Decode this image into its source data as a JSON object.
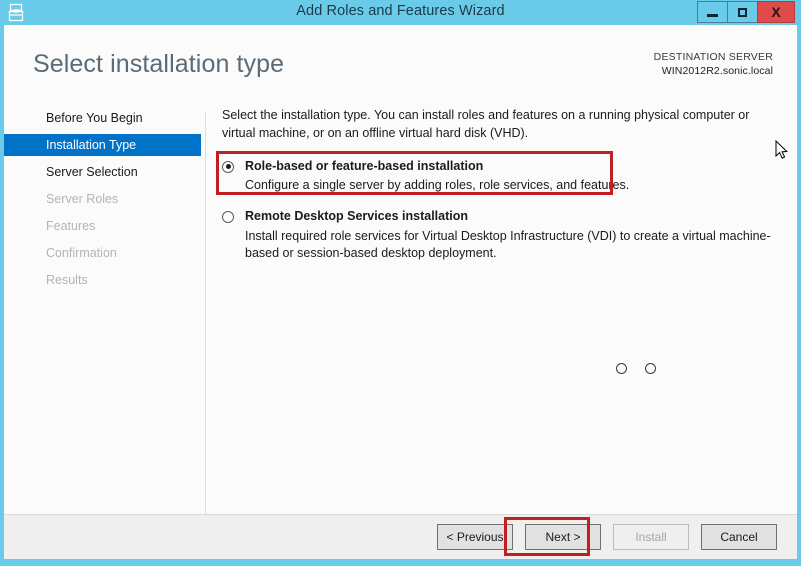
{
  "window": {
    "title": "Add Roles and Features Wizard",
    "icon": "server-wizard-icon",
    "titlebar_color": "#6ACBE8",
    "controls": {
      "minimize": "minimize-icon",
      "maximize": "maximize-icon",
      "close_label": "X"
    }
  },
  "header": {
    "page_title": "Select installation type",
    "destination_label": "DESTINATION SERVER",
    "destination_server": "WIN2012R2.sonic.local"
  },
  "sidebar": {
    "items": [
      {
        "label": "Before You Begin",
        "state": "enabled"
      },
      {
        "label": "Installation Type",
        "state": "selected"
      },
      {
        "label": "Server Selection",
        "state": "enabled"
      },
      {
        "label": "Server Roles",
        "state": "disabled"
      },
      {
        "label": "Features",
        "state": "disabled"
      },
      {
        "label": "Confirmation",
        "state": "disabled"
      },
      {
        "label": "Results",
        "state": "disabled"
      }
    ],
    "selected_color": "#0073C8"
  },
  "main": {
    "intro": "Select the installation type. You can install roles and features on a running physical computer or virtual machine, or on an offline virtual hard disk (VHD).",
    "options": [
      {
        "title": "Role-based or feature-based installation",
        "description": "Configure a single server by adding roles, role services, and features.",
        "selected": true
      },
      {
        "title": "Remote Desktop Services installation",
        "description": "Install required role services for Virtual Desktop Infrastructure (VDI) to create a virtual machine-based or session-based desktop deployment.",
        "selected": false
      }
    ]
  },
  "footer": {
    "buttons": [
      {
        "label": "< Previous",
        "state": "enabled"
      },
      {
        "label": "Next >",
        "state": "enabled"
      },
      {
        "label": "Install",
        "state": "disabled"
      },
      {
        "label": "Cancel",
        "state": "enabled"
      }
    ]
  },
  "annotations": {
    "color": "#c0201f",
    "highlight_option": "Role-based or feature-based installation",
    "highlight_button": "Next >"
  }
}
